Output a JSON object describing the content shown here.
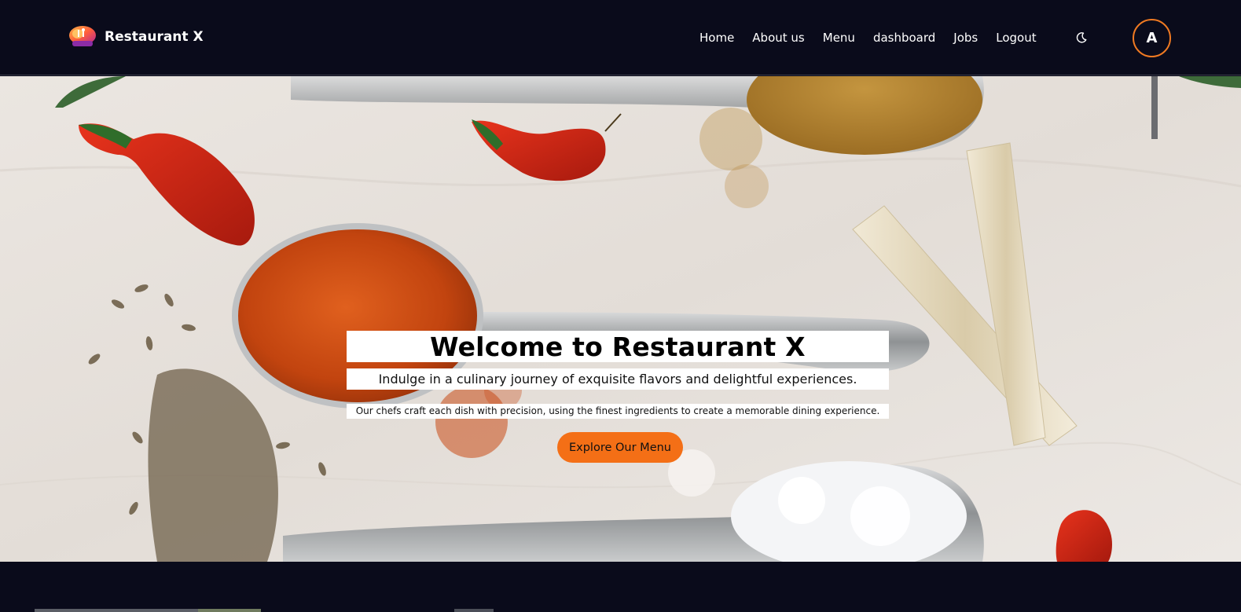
{
  "header": {
    "brand_name": "Restaurant X",
    "nav": {
      "home": "Home",
      "about": "About us",
      "menu": "Menu",
      "dashboard": "dashboard",
      "jobs": "Jobs",
      "logout": "Logout"
    },
    "theme_icon": "moon-icon",
    "avatar_letter": "A"
  },
  "hero": {
    "title": "Welcome to Restaurant X",
    "subtitle": "Indulge in a culinary journey of exquisite flavors and delightful experiences.",
    "description": "Our chefs craft each dish with precision, using the finest ingredients to create a memorable dining experience.",
    "cta_label": "Explore Our Menu"
  },
  "colors": {
    "background": "#0a0b1b",
    "accent": "#f46f16",
    "avatar_border": "#f07a22"
  }
}
